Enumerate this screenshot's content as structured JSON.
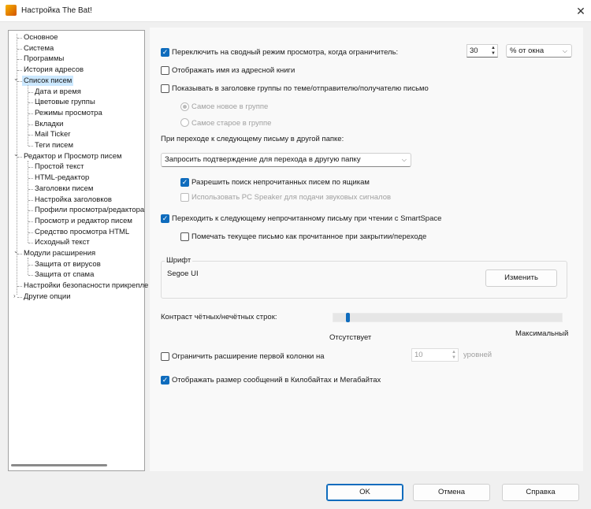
{
  "window": {
    "title": "Настройка The Bat!",
    "close": "✕"
  },
  "tree": {
    "items": [
      {
        "label": "Основное",
        "level": 0
      },
      {
        "label": "Система",
        "level": 0
      },
      {
        "label": "Программы",
        "level": 0
      },
      {
        "label": "История адресов",
        "level": 0
      },
      {
        "label": "Список писем",
        "level": 0,
        "expanded": true,
        "selected": true
      },
      {
        "label": "Дата и время",
        "level": 1
      },
      {
        "label": "Цветовые группы",
        "level": 1
      },
      {
        "label": "Режимы просмотра",
        "level": 1
      },
      {
        "label": "Вкладки",
        "level": 1
      },
      {
        "label": "Mail Ticker",
        "level": 1
      },
      {
        "label": "Теги писем",
        "level": 1
      },
      {
        "label": "Редактор и Просмотр писем",
        "level": 0,
        "expanded": true
      },
      {
        "label": "Простой текст",
        "level": 1
      },
      {
        "label": "HTML-редактор",
        "level": 1
      },
      {
        "label": "Заголовки писем",
        "level": 1
      },
      {
        "label": "Настройка заголовков",
        "level": 1
      },
      {
        "label": "Профили просмотра/редактора",
        "level": 1
      },
      {
        "label": "Просмотр и редактор писем",
        "level": 1
      },
      {
        "label": "Средство просмотра HTML",
        "level": 1
      },
      {
        "label": "Исходный текст",
        "level": 1
      },
      {
        "label": "Модули расширения",
        "level": 0,
        "expanded": true
      },
      {
        "label": "Защита от вирусов",
        "level": 1
      },
      {
        "label": "Защита от спама",
        "level": 1
      },
      {
        "label": "Настройки безопасности прикрепле",
        "level": 0
      },
      {
        "label": "Другие опции",
        "level": 0,
        "collapsed": true
      }
    ]
  },
  "options": {
    "summary_mode": {
      "label": "Переключить на сводный режим просмотра, когда ограничитель:",
      "checked": true,
      "value": "30",
      "unit": "% от окна"
    },
    "show_addressbook_name": {
      "label": "Отображать имя из адресной книги",
      "checked": false
    },
    "group_header": {
      "label": "Показывать в заголовке группы по теме/отправителю/получателю письмо",
      "checked": false
    },
    "radio_newest": {
      "label": "Самое новое в группе",
      "selected": true
    },
    "radio_oldest": {
      "label": "Самое старое в группе",
      "selected": false
    },
    "next_folder_label": "При переходе к следующему письму в другой папке:",
    "next_folder_value": "Запросить подтверждение для перехода в другую папку",
    "search_unread": {
      "label": "Разрешить поиск непрочитанных писем по ящикам",
      "checked": true
    },
    "pc_speaker": {
      "label": "Использовать PC Speaker для подачи звуковых сигналов",
      "checked": false
    },
    "smartspace": {
      "label": "Переходить к следующему непрочитанному письму при чтении с SmartSpace",
      "checked": true
    },
    "mark_read": {
      "label": "Помечать текущее письмо как прочитанное при закрытии/переходе",
      "checked": false
    },
    "font": {
      "group": "Шрифт",
      "name": "Segoe UI",
      "change": "Изменить"
    },
    "contrast": {
      "label": "Контраст чётных/нечётных строк:",
      "min": "Отсутствует",
      "max": "Максимальный",
      "value": 0.06
    },
    "limit_first_col": {
      "label": "Ограничить расширение первой колонки на",
      "checked": false,
      "value": "10",
      "unit": "уровней"
    },
    "show_size": {
      "label": "Отображать размер сообщений в Килобайтах и Мегабайтах",
      "checked": true
    }
  },
  "buttons": {
    "ok": "OK",
    "cancel": "Отмена",
    "help": "Справка"
  }
}
